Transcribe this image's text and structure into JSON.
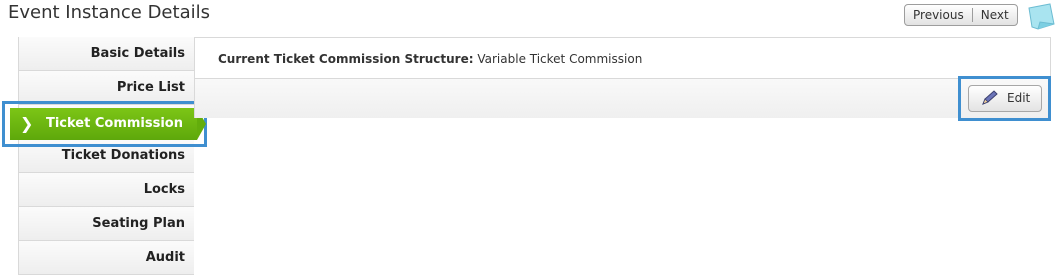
{
  "header": {
    "title": "Event Instance Details",
    "prev_label": "Previous",
    "next_label": "Next"
  },
  "sidebar": {
    "items": [
      {
        "label": "Basic Details"
      },
      {
        "label": "Price List"
      },
      {
        "label": "Ticket Commission",
        "active": true
      },
      {
        "label": "Ticket Donations"
      },
      {
        "label": "Locks"
      },
      {
        "label": "Seating Plan"
      },
      {
        "label": "Audit"
      }
    ],
    "chevron": "❯"
  },
  "main": {
    "structure_label": "Current Ticket Commission Structure:",
    "structure_value": "Variable Ticket Commission",
    "edit_label": "Edit"
  },
  "colors": {
    "accent_green": "#6bb712",
    "highlight_blue": "#3f8fd0"
  },
  "icons": {
    "note": "sticky-note-icon",
    "pencil": "pencil-icon"
  }
}
